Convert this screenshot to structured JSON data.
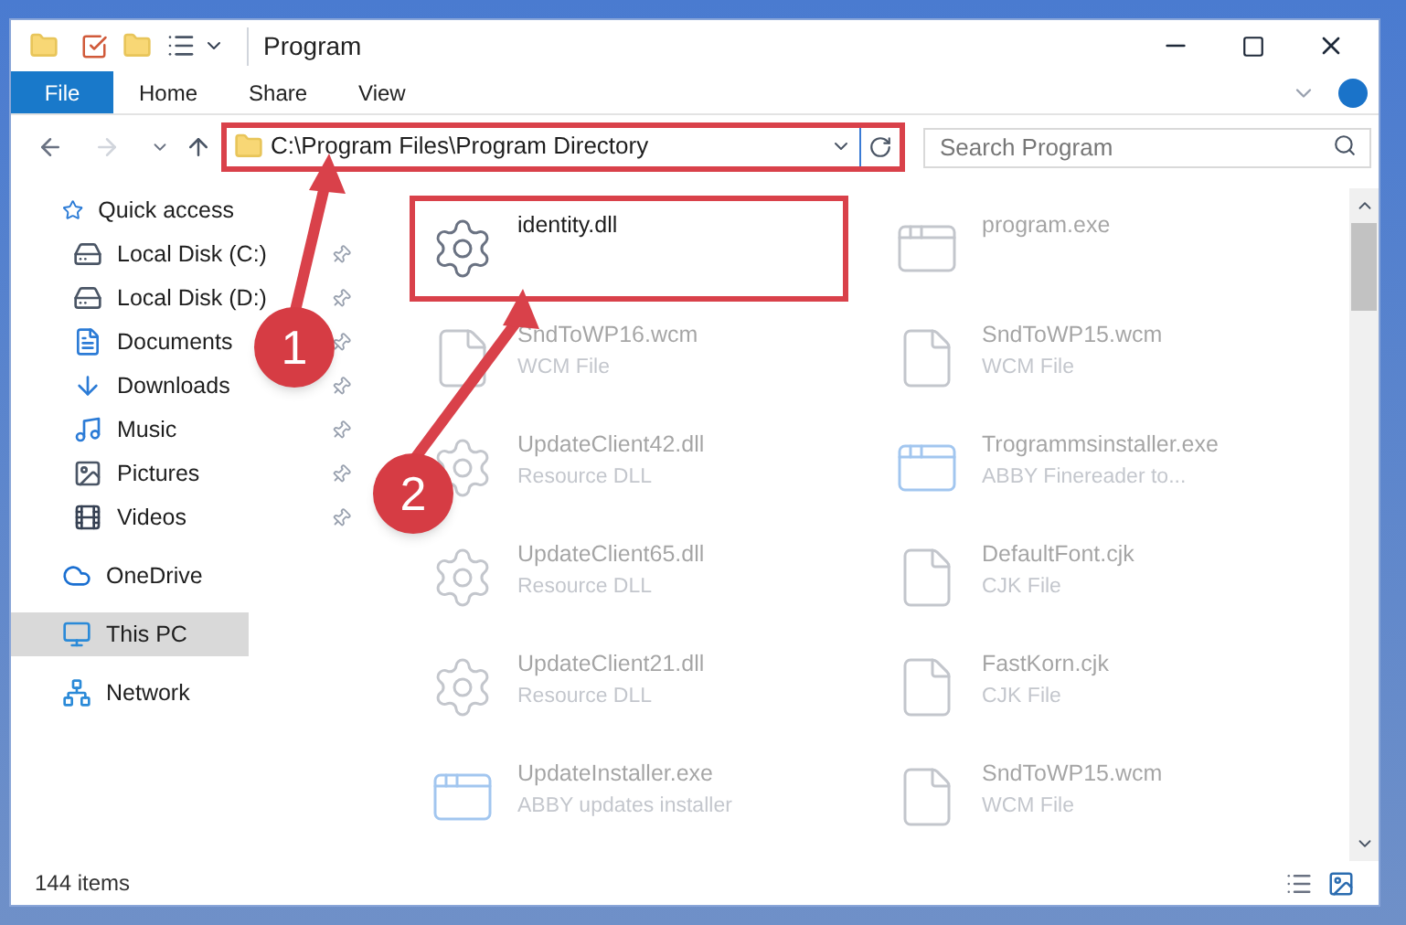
{
  "window": {
    "title": "Program"
  },
  "ribbon_tabs": [
    {
      "label": "File",
      "selected": true
    },
    {
      "label": "Home",
      "selected": false
    },
    {
      "label": "Share",
      "selected": false
    },
    {
      "label": "View",
      "selected": false
    }
  ],
  "address": {
    "value": "C:\\Program Files\\Program Directory",
    "highlighted": true
  },
  "search": {
    "placeholder": "Search Program"
  },
  "sidebar": {
    "items": [
      {
        "label": "Quick access",
        "kind": "star",
        "selected": false,
        "children": [
          {
            "label": "Local Disk (C:)",
            "kind": "drive",
            "pinned": true
          },
          {
            "label": "Local Disk (D:)",
            "kind": "drive",
            "pinned": true
          },
          {
            "label": "Documents",
            "kind": "documents",
            "pinned": true
          },
          {
            "label": "Downloads",
            "kind": "downloads",
            "pinned": true
          },
          {
            "label": "Music",
            "kind": "music",
            "pinned": true
          },
          {
            "label": "Pictures",
            "kind": "pictures",
            "pinned": true
          },
          {
            "label": "Videos",
            "kind": "videos",
            "pinned": true
          }
        ]
      },
      {
        "label": "OneDrive",
        "kind": "cloud",
        "selected": false
      },
      {
        "label": "This PC",
        "kind": "pc",
        "selected": true
      },
      {
        "label": "Network",
        "kind": "network",
        "selected": false
      }
    ]
  },
  "files": [
    {
      "name": "identity.dll",
      "kind": "dll",
      "highlighted": true
    },
    {
      "name": "program.exe",
      "kind": "exe",
      "highlighted": false
    },
    {
      "name": "SndToWP16.wcm",
      "type": "WCM File",
      "kind": "blank",
      "highlighted": false
    },
    {
      "name": "SndToWP15.wcm",
      "type": "WCM File",
      "kind": "blank",
      "highlighted": false
    },
    {
      "name": "UpdateClient42.dll",
      "type": "Resource DLL",
      "kind": "dll",
      "highlighted": false
    },
    {
      "name": "Trogrammsinstaller.exe",
      "type": "ABBY Finereader to...",
      "kind": "installer",
      "highlighted": false
    },
    {
      "name": "UpdateClient65.dll",
      "type": "Resource DLL",
      "kind": "dll",
      "highlighted": false
    },
    {
      "name": "DefaultFont.cjk",
      "type": "CJK File",
      "kind": "blank",
      "highlighted": false
    },
    {
      "name": "UpdateClient21.dll",
      "type": "Resource DLL",
      "kind": "dll",
      "highlighted": false
    },
    {
      "name": "FastKorn.cjk",
      "type": "CJK File",
      "kind": "blank",
      "highlighted": false
    },
    {
      "name": "UpdateInstaller.exe",
      "type": "ABBY updates installer",
      "kind": "installer",
      "highlighted": false
    },
    {
      "name": "SndToWP15.wcm",
      "type": "WCM File",
      "kind": "blank",
      "highlighted": false
    }
  ],
  "status_bar": {
    "count": "144 items"
  },
  "callouts": [
    {
      "number": "1"
    },
    {
      "number": "2"
    }
  ]
}
